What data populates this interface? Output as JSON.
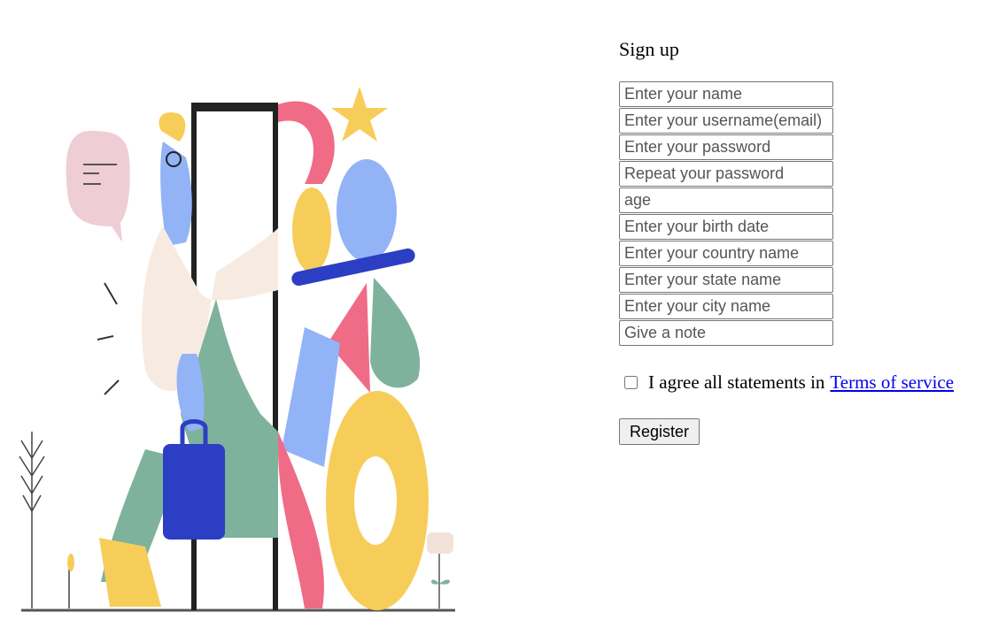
{
  "form": {
    "title": "Sign up",
    "fields": [
      {
        "placeholder": "Enter your name",
        "value": ""
      },
      {
        "placeholder": "Enter your username(email)",
        "value": ""
      },
      {
        "placeholder": "Enter your password",
        "value": ""
      },
      {
        "placeholder": "Repeat your password",
        "value": ""
      },
      {
        "placeholder": "age",
        "value": ""
      },
      {
        "placeholder": "Enter your birth date",
        "value": ""
      },
      {
        "placeholder": "Enter your country name",
        "value": ""
      },
      {
        "placeholder": "Enter your state name",
        "value": ""
      },
      {
        "placeholder": "Enter your city name",
        "value": ""
      },
      {
        "placeholder": "Give a note",
        "value": ""
      }
    ],
    "agree_text": "I agree all statements in",
    "terms_link": "Terms of service",
    "register_label": "Register",
    "agree_checked": false
  },
  "colors": {
    "link": "#0000ee",
    "illustration_pink": "#ef6b86",
    "illustration_yellow": "#f7cd5a",
    "illustration_blue": "#93b3f7",
    "illustration_green": "#7fb29d",
    "illustration_navy": "#2b3ec4"
  }
}
